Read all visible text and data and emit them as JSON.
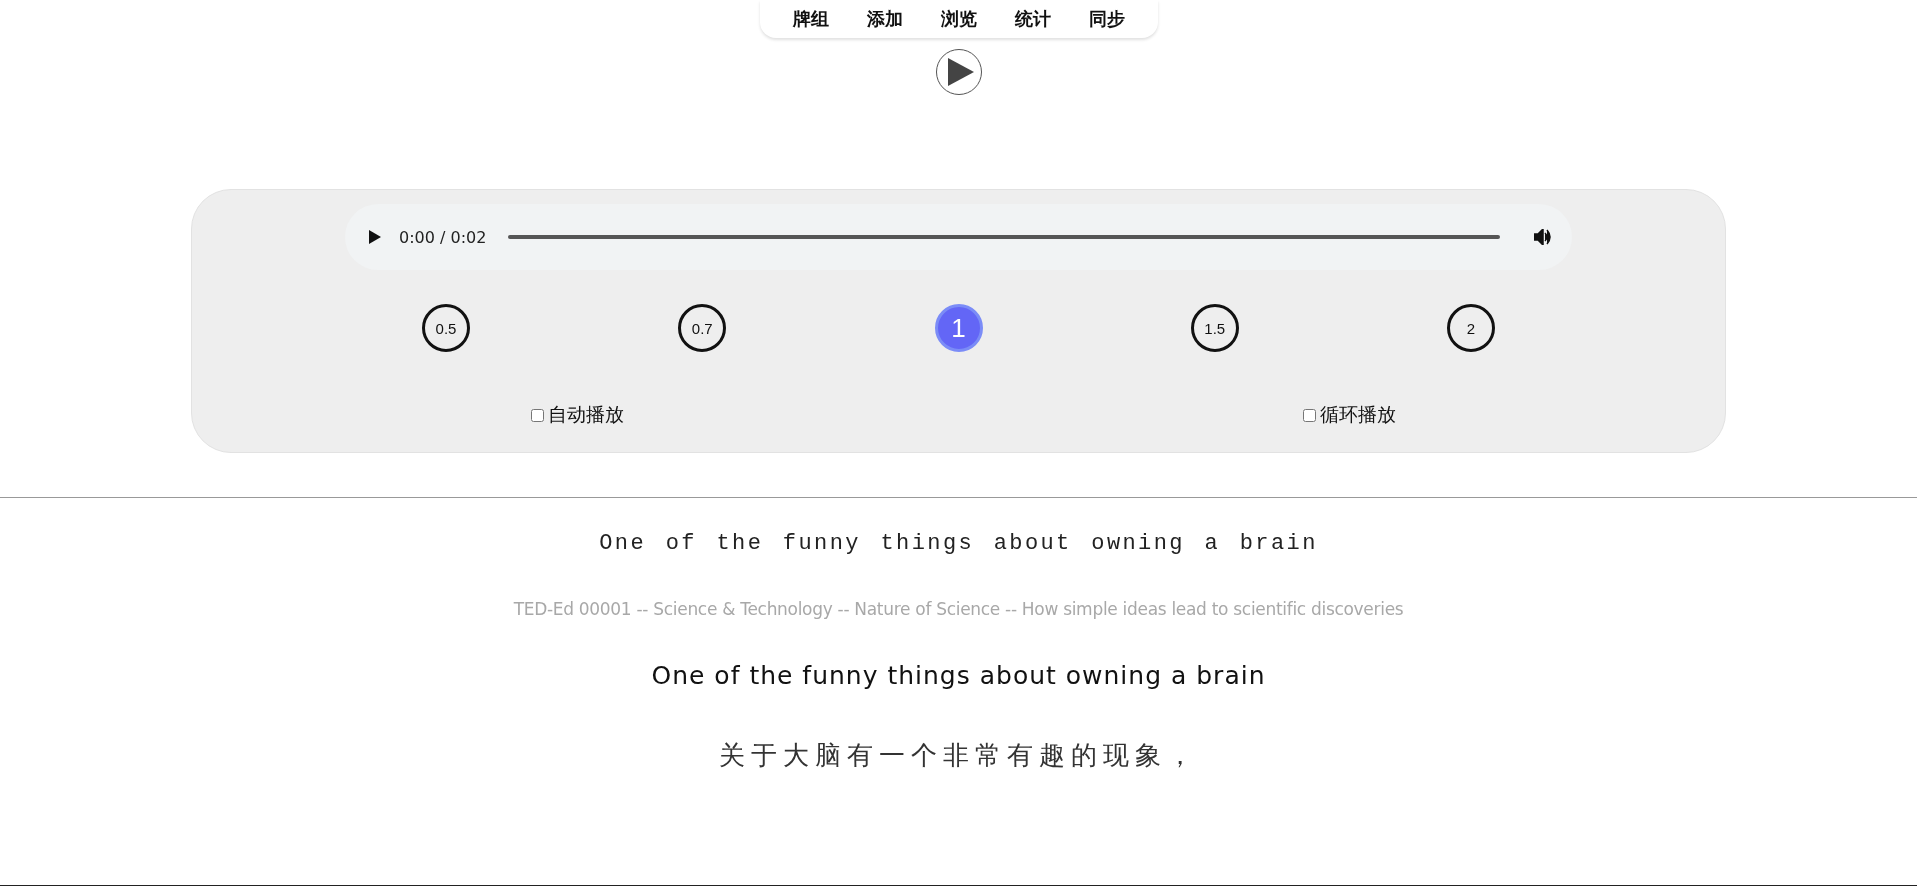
{
  "nav": {
    "items": [
      {
        "label": "牌组"
      },
      {
        "label": "添加"
      },
      {
        "label": "浏览"
      },
      {
        "label": "统计"
      },
      {
        "label": "同步"
      }
    ]
  },
  "player": {
    "time": "0:00 / 0:02",
    "speeds": [
      {
        "label": "0.5",
        "selected": false
      },
      {
        "label": "0.7",
        "selected": false
      },
      {
        "label": "1",
        "selected": true
      },
      {
        "label": "1.5",
        "selected": false
      },
      {
        "label": "2",
        "selected": false
      }
    ],
    "options": [
      {
        "label": "自动播放",
        "checked": false
      },
      {
        "label": "循环播放",
        "checked": false
      }
    ]
  },
  "card": {
    "front": "One of the funny things about owning a brain",
    "source": "TED-Ed 00001 -- Science & Technology -- Nature of Science -- How simple ideas lead to scientific discoveries",
    "sentence": "One of the funny things about owning a brain",
    "translation": "关于大脑有一个非常有趣的现象，"
  }
}
